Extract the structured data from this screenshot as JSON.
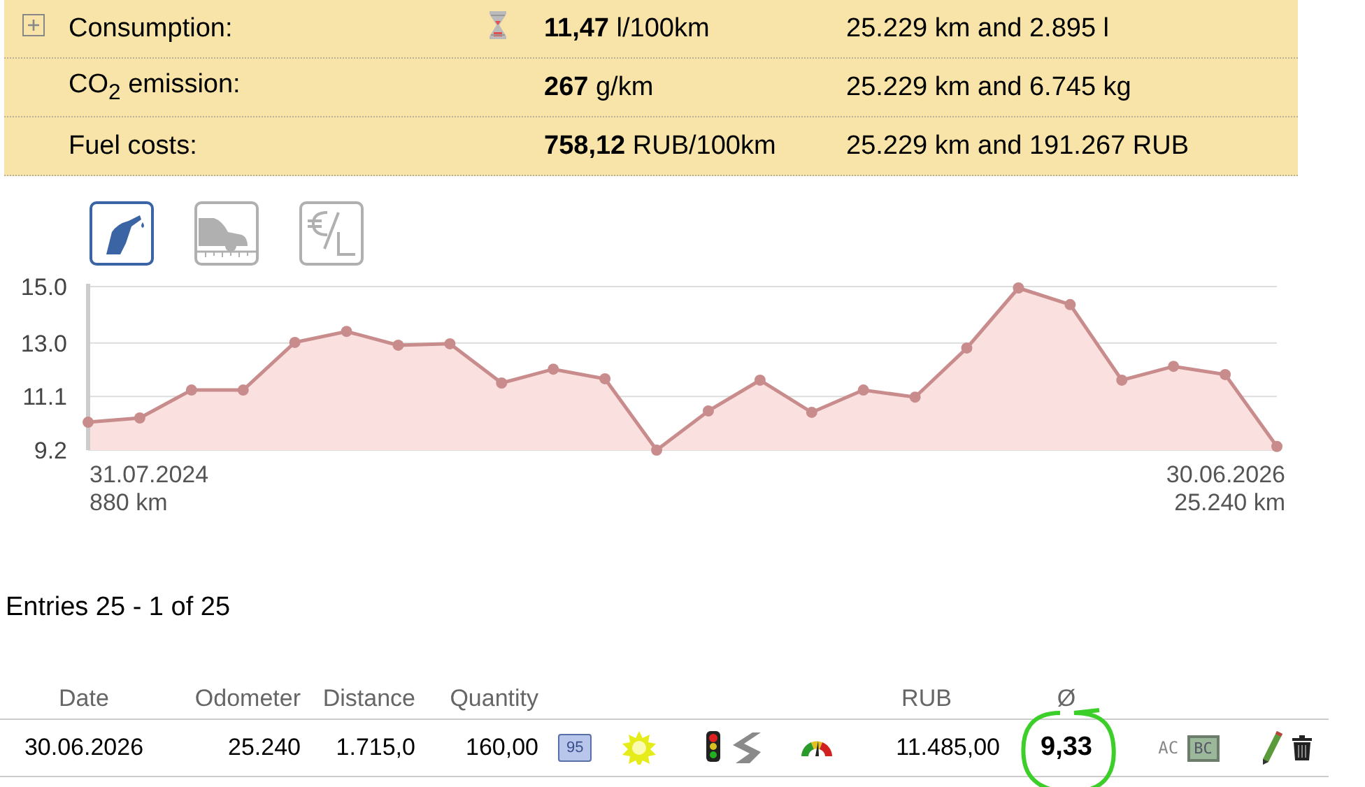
{
  "summary": {
    "expanded": false,
    "rows": [
      {
        "label": "Consumption:",
        "kind": "consumption",
        "value": "11,47",
        "unit": "l/100km",
        "detail": "25.229 km and 2.895 l"
      },
      {
        "label": "CO$_{2}$ emission:",
        "kind": "plain",
        "value": "267",
        "unit": "g/km",
        "detail": "25.229 km and 6.745 kg"
      },
      {
        "label": "Fuel costs:",
        "kind": "plain",
        "value": "758,12",
        "unit": "RUB/100km",
        "detail": "25.229 km and 191.267 RUB"
      }
    ]
  },
  "chart_tabs": [
    {
      "kind": "fuel",
      "selected": true
    },
    {
      "kind": "distance",
      "selected": false
    },
    {
      "kind": "price",
      "selected": false
    }
  ],
  "chart": {
    "start_date": "31.07.2024",
    "start_distance": "880 km",
    "end_date": "30.06.2026",
    "end_distance": "25.240 km",
    "chart_data": {
      "type": "area",
      "series": [
        {
          "color": "#c98c8c",
          "values": [
            10.19,
            10.34,
            11.33,
            11.33,
            13.02,
            13.41,
            12.92,
            12.97,
            11.58,
            12.07,
            11.73,
            9.2,
            10.59,
            11.68,
            10.54,
            11.33,
            11.08,
            12.82,
            14.95,
            14.36,
            11.68,
            12.17,
            11.88,
            9.33
          ]
        }
      ],
      "ylim": [
        9.2,
        15.0
      ],
      "yticks": [
        {
          "value": 9.2,
          "label": "9.2"
        },
        {
          "value": 11.1,
          "label": "11.1"
        },
        {
          "value": 13,
          "label": "13.0"
        },
        {
          "value": 15,
          "label": "15.0"
        }
      ]
    }
  },
  "entries_label": "Entries 25 - 1 of 25",
  "table": {
    "columns": [
      "Date",
      "Odometer",
      "Distance",
      "Quantity",
      "RUB",
      "Ø"
    ],
    "rows": [
      {
        "date": "30.06.2026",
        "odometer": "25.240",
        "distance": "1.715,0",
        "quantity": "160,00",
        "fuel_grade": "95",
        "cost": "11.485,00",
        "average": "9,33",
        "average_circled": true,
        "ac": "AC",
        "bc": "BC"
      }
    ]
  }
}
